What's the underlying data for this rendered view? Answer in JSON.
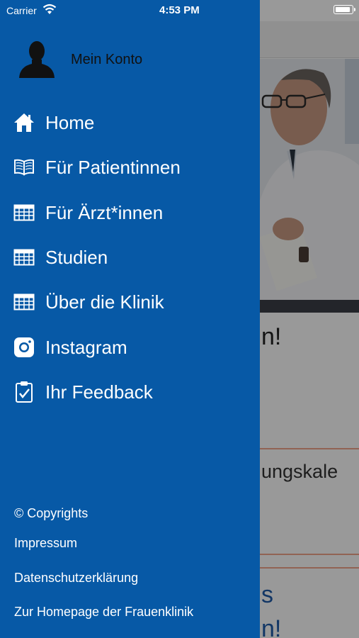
{
  "status_bar": {
    "carrier": "Carrier",
    "time": "4:53 PM",
    "battery_level": 0.95
  },
  "account": {
    "label": "Mein Konto",
    "icon": "user-silhouette-icon"
  },
  "menu": {
    "items": [
      {
        "label": "Home",
        "icon": "home-icon"
      },
      {
        "label": "Für Patientinnen",
        "icon": "book-icon"
      },
      {
        "label": "Für Ärzt*innen",
        "icon": "table-icon"
      },
      {
        "label": "Studien",
        "icon": "table-icon"
      },
      {
        "label": "Über die Klinik",
        "icon": "table-icon"
      },
      {
        "label": "Instagram",
        "icon": "instagram-icon"
      },
      {
        "label": "Ihr Feedback",
        "icon": "clipboard-check-icon"
      }
    ]
  },
  "footer": {
    "copyright": "© Copyrights",
    "impressum": "Impressum",
    "datenschutz": "Datenschutzerklärung",
    "homepage": "Zur Homepage der Frauenklinik"
  },
  "background": {
    "text1": "n!",
    "text2": "ungskale",
    "text3_line1": "s",
    "text3_line2": "n!"
  },
  "colors": {
    "drawer": "#0759a6",
    "accent_line": "#f2a58c",
    "link_blue": "#1e5aa8"
  }
}
